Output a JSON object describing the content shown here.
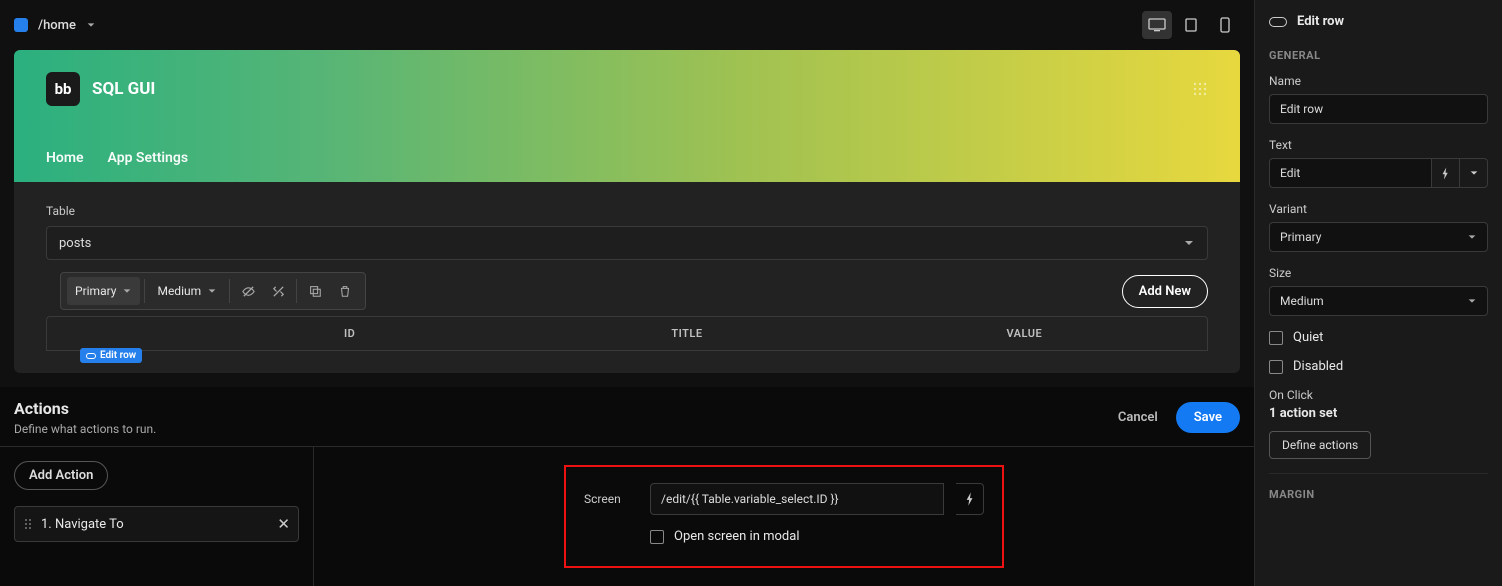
{
  "topbar": {
    "breadcrumb": "/home"
  },
  "app": {
    "logo_text": "bb",
    "title": "SQL GUI",
    "nav": [
      "Home",
      "App Settings"
    ]
  },
  "table_section": {
    "label": "Table",
    "selected": "posts",
    "add_new": "Add New",
    "toolbar": {
      "variant": "Primary",
      "size": "Medium"
    },
    "columns": [
      "",
      "ID",
      "TITLE",
      "VALUE"
    ],
    "row_chip": "Edit row"
  },
  "actions_popup": {
    "title": "Actions",
    "subtitle": "Define what actions to run.",
    "cancel": "Cancel",
    "save": "Save",
    "add_action": "Add Action",
    "action_list": [
      "1. Navigate To"
    ],
    "form": {
      "screen_label": "Screen",
      "screen_value": "/edit/{{ Table.variable_select.ID }}",
      "modal_label": "Open screen in modal"
    }
  },
  "props": {
    "component": "Edit row",
    "section_general": "GENERAL",
    "name_label": "Name",
    "name_value": "Edit row",
    "text_label": "Text",
    "text_value": "Edit",
    "variant_label": "Variant",
    "variant_value": "Primary",
    "size_label": "Size",
    "size_value": "Medium",
    "quiet_label": "Quiet",
    "disabled_label": "Disabled",
    "onclick_label": "On Click",
    "onclick_value": "1 action set",
    "define_actions": "Define actions",
    "section_margin": "MARGIN"
  }
}
